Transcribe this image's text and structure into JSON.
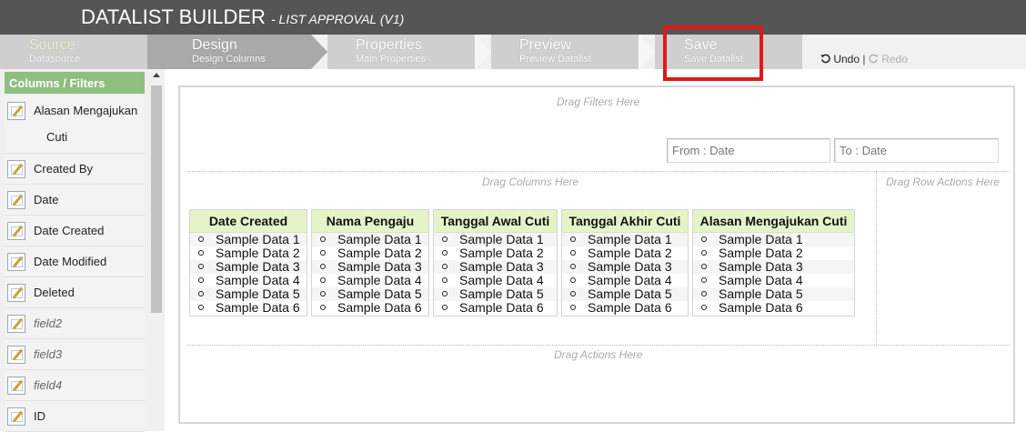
{
  "app": {
    "title": "DATALIST BUILDER",
    "subtitle": "- LIST APPROVAL (V1)"
  },
  "steps": [
    {
      "title": "Source",
      "sub": "Datasource"
    },
    {
      "title": "Design",
      "sub": "Design Columns"
    },
    {
      "title": "Properties",
      "sub": "Main Properties"
    },
    {
      "title": "Preview",
      "sub": "Preview Datalist"
    },
    {
      "title": "Save",
      "sub": "Save Datalist"
    }
  ],
  "history": {
    "undo_icon": "undo-icon",
    "undo": "Undo",
    "separator": "|",
    "redo_icon": "redo-icon",
    "redo": "Redo"
  },
  "sidebar": {
    "header": "Columns / Filters",
    "items": [
      {
        "line1": "Alasan Mengajukan",
        "line2": "Cuti"
      },
      {
        "line1": "Created By"
      },
      {
        "line1": "Date"
      },
      {
        "line1": "Date Created"
      },
      {
        "line1": "Date Modified"
      },
      {
        "line1": "Deleted"
      },
      {
        "line1": "field2"
      },
      {
        "line1": "field3"
      },
      {
        "line1": "field4"
      },
      {
        "line1": "ID"
      }
    ]
  },
  "canvas": {
    "drag_filters": "Drag Filters Here",
    "filter_from_placeholder": "From : Date",
    "filter_to_placeholder": "To : Date",
    "drag_columns": "Drag Columns Here",
    "drag_row_actions": "Drag Row Actions Here",
    "drag_actions": "Drag Actions Here"
  },
  "columns": [
    {
      "header": "Date Created",
      "rows": [
        "Sample Data 1",
        "Sample Data 2",
        "Sample Data 3",
        "Sample Data 4",
        "Sample Data 5",
        "Sample Data 6"
      ]
    },
    {
      "header": "Nama Pengaju",
      "rows": [
        "Sample Data 1",
        "Sample Data 2",
        "Sample Data 3",
        "Sample Data 4",
        "Sample Data 5",
        "Sample Data 6"
      ]
    },
    {
      "header": "Tanggal Awal Cuti",
      "rows": [
        "Sample Data 1",
        "Sample Data 2",
        "Sample Data 3",
        "Sample Data 4",
        "Sample Data 5",
        "Sample Data 6"
      ]
    },
    {
      "header": "Tanggal Akhir Cuti",
      "rows": [
        "Sample Data 1",
        "Sample Data 2",
        "Sample Data 3",
        "Sample Data 4",
        "Sample Data 5",
        "Sample Data 6"
      ]
    },
    {
      "header": "Alasan Mengajukan Cuti",
      "rows": [
        "Sample Data 1",
        "Sample Data 2",
        "Sample Data 3",
        "Sample Data 4",
        "Sample Data 5",
        "Sample Data 6"
      ]
    }
  ],
  "colors": {
    "titlebar": "#555555",
    "step_active": "#a9a9a9",
    "step_inactive": "#cfcfcf",
    "palette_header": "#8fbf7f",
    "column_header": "#e5f4c8",
    "highlight": "#e01818"
  }
}
